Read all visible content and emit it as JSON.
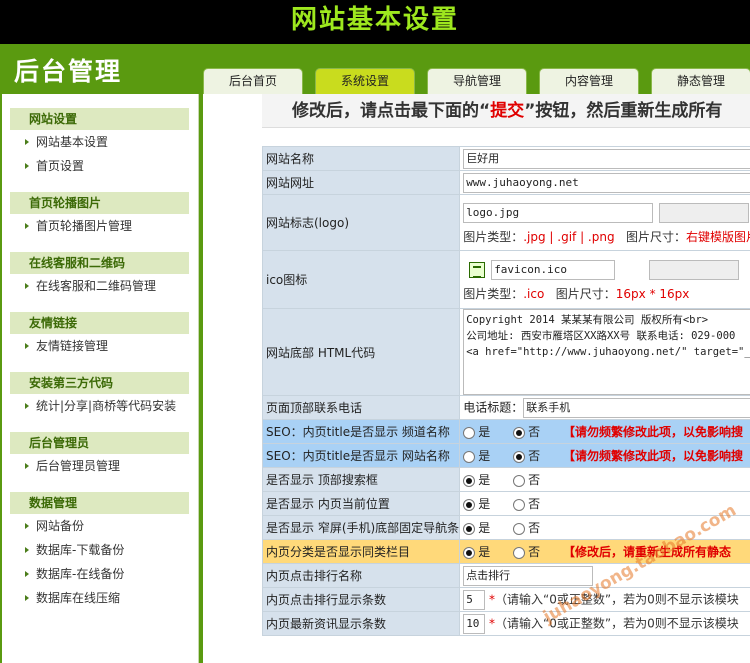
{
  "page_title": "网站基本设置",
  "logo": "后台管理",
  "tabs": [
    {
      "label": "后台首页"
    },
    {
      "label": "系统设置"
    },
    {
      "label": "导航管理"
    },
    {
      "label": "内容管理"
    },
    {
      "label": "静态管理"
    }
  ],
  "sidebar": [
    {
      "title": "网站设置",
      "items": [
        "网站基本设置",
        "首页设置"
      ]
    },
    {
      "title": "首页轮播图片",
      "items": [
        "首页轮播图片管理"
      ]
    },
    {
      "title": "在线客服和二维码",
      "items": [
        "在线客服和二维码管理"
      ]
    },
    {
      "title": "友情链接",
      "items": [
        "友情链接管理"
      ]
    },
    {
      "title": "安装第三方代码",
      "items": [
        "统计|分享|商桥等代码安装"
      ]
    },
    {
      "title": "后台管理员",
      "items": [
        "后台管理员管理"
      ]
    },
    {
      "title": "数据管理",
      "items": [
        "网站备份",
        "数据库-下载备份",
        "数据库-在线备份",
        "数据库在线压缩"
      ]
    }
  ],
  "banner": {
    "before": "修改后，请点击最下面的“",
    "highlight": "提交",
    "after": "”按钮，然后重新生成所有"
  },
  "form": {
    "site_name": {
      "label": "网站名称",
      "value": "巨好用"
    },
    "site_url": {
      "label": "网站网址",
      "value": "www.juhaoyong.net"
    },
    "logo": {
      "label": "网站标志(logo)",
      "value": "logo.jpg",
      "type_label": "图片类型：",
      "types": ".jpg | .gif | .png",
      "size_label": "图片尺寸：",
      "size_value": "右键模版图片"
    },
    "ico": {
      "label": "ico图标",
      "value": "favicon.ico",
      "type_label": "图片类型：",
      "types": ".ico",
      "size_label": "图片尺寸：",
      "size_value": "16px * 16px"
    },
    "footer": {
      "label": "网站底部 HTML代码",
      "value": "Copyright 2014 某某某有限公司 版权所有<br>\n公司地址: 西安市雁塔区XX路XX号 联系电话: 029-000\n<a href=\"http://www.juhaoyong.net/\" target=\"_bla"
    },
    "phone": {
      "label": "页面顶部联系电话",
      "sublabel": "电话标题：",
      "value": "联系手机"
    },
    "seo_channel": {
      "label": "SEO：内页title是否显示 频道名称",
      "yes": "是",
      "no": "否",
      "selected": "no",
      "warning": "【请勿频繁修改此项，以免影响搜"
    },
    "seo_sitename": {
      "label": "SEO：内页title是否显示 网站名称",
      "yes": "是",
      "no": "否",
      "selected": "no",
      "warning": "【请勿频繁修改此项，以免影响搜"
    },
    "show_search": {
      "label": "是否显示 顶部搜索框",
      "yes": "是",
      "no": "否",
      "selected": "yes"
    },
    "show_position": {
      "label": "是否显示 内页当前位置",
      "yes": "是",
      "no": "否",
      "selected": "yes"
    },
    "show_mobile_nav": {
      "label": "是否显示 窄屏(手机)底部固定导航条",
      "yes": "是",
      "no": "否",
      "selected": "yes"
    },
    "show_same_cat": {
      "label": "内页分类是否显示同类栏目",
      "yes": "是",
      "no": "否",
      "selected": "yes",
      "warning": "【修改后，请重新生成所有静态"
    },
    "rank_name": {
      "label": "内页点击排行名称",
      "value": "点击排行"
    },
    "rank_count": {
      "label": "内页点击排行显示条数",
      "value": "5",
      "star": "*",
      "hint": "（请输入“0或正整数”，若为0则不显示该模块"
    },
    "news_count": {
      "label": "内页最新资讯显示条数",
      "value": "10",
      "star": "*",
      "hint": "（请输入“0或正整数”，若为0则不显示该模块"
    }
  },
  "watermark": "juhaoyong.taobao.com",
  "colors": {
    "topbar": "#000000",
    "title": "#9ee81e",
    "header": "#5a9a10",
    "active_tab": "#c9dc1e",
    "seo_row": "#a9d1f5",
    "highlight_row": "#ffd97a",
    "warning": "#e00000"
  }
}
